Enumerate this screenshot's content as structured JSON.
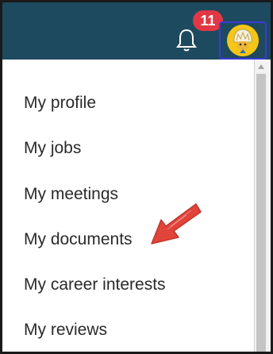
{
  "header": {
    "notifications": {
      "count": "11",
      "icon": "bell-icon"
    },
    "avatar": {
      "icon": "avatar-icon"
    }
  },
  "menu": {
    "items": [
      {
        "label": "My profile"
      },
      {
        "label": "My jobs"
      },
      {
        "label": "My meetings"
      },
      {
        "label": "My documents"
      },
      {
        "label": "My career interests"
      },
      {
        "label": "My reviews"
      }
    ]
  },
  "colors": {
    "header_bg": "#1e4a5f",
    "badge": "#e23744",
    "avatar_border": "#3a3ad8",
    "annotation_arrow": "#e0443a"
  }
}
